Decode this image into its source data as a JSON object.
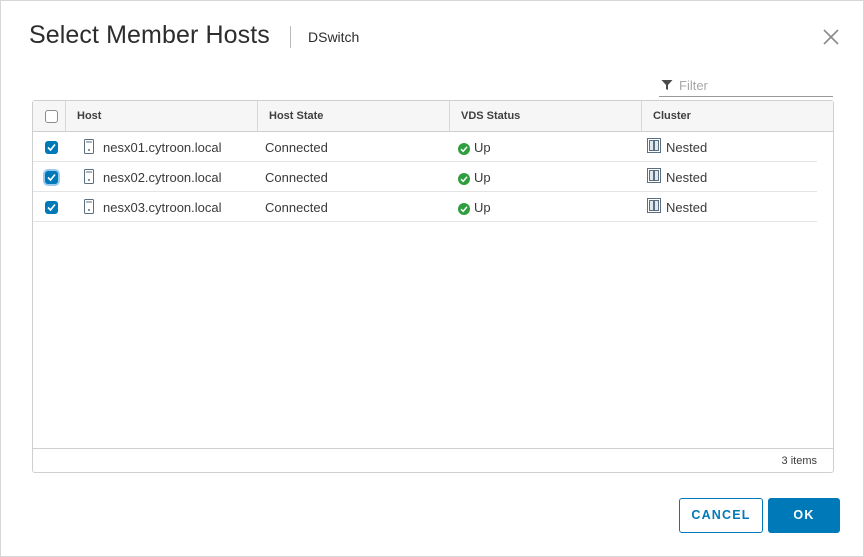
{
  "dialog": {
    "title": "Select Member Hosts",
    "subtitle": "DSwitch",
    "close_icon": "close-icon"
  },
  "filter": {
    "placeholder": "Filter",
    "value": "",
    "icon": "funnel-icon"
  },
  "grid": {
    "columns": [
      "Host",
      "Host State",
      "VDS Status",
      "Cluster"
    ],
    "select_all_checked": false,
    "rows": [
      {
        "checked": true,
        "focused": false,
        "host": "nesx01.cytroon.local",
        "host_state": "Connected",
        "vds_status": "Up",
        "cluster": "Nested"
      },
      {
        "checked": true,
        "focused": true,
        "host": "nesx02.cytroon.local",
        "host_state": "Connected",
        "vds_status": "Up",
        "cluster": "Nested"
      },
      {
        "checked": true,
        "focused": false,
        "host": "nesx03.cytroon.local",
        "host_state": "Connected",
        "vds_status": "Up",
        "cluster": "Nested"
      }
    ],
    "footer_count": "3 items"
  },
  "buttons": {
    "cancel": "CANCEL",
    "ok": "OK"
  },
  "colors": {
    "primary": "#0079b8",
    "status_up": "#2f9e3f",
    "header_bg": "#f6f6f6"
  },
  "icons": {
    "host": "host-server-icon",
    "status_up": "check-circle-icon",
    "cluster": "cluster-icon"
  }
}
